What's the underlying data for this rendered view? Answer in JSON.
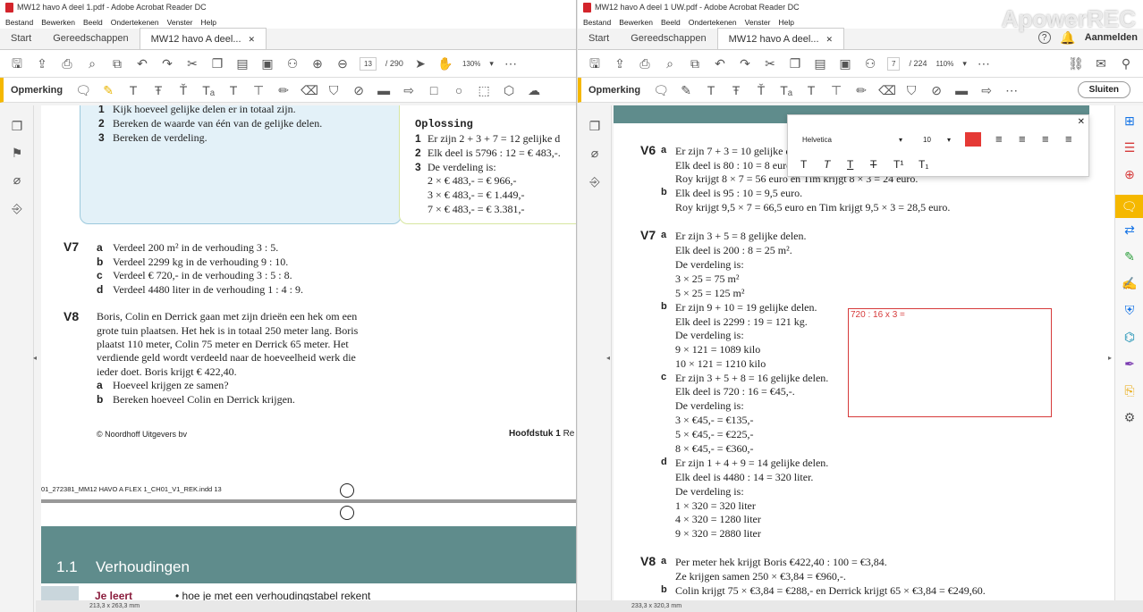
{
  "left": {
    "title": "MW12 havo A deel 1.pdf - Adobe Acrobat Reader DC",
    "menu": [
      "Bestand",
      "Bewerken",
      "Beeld",
      "Ondertekenen",
      "Venster",
      "Help"
    ],
    "tabs": {
      "start": "Start",
      "tools": "Gereedschappen",
      "doc": "MW12 havo A deel..."
    },
    "page_current": "13",
    "page_total": "/ 290",
    "zoom": "130%",
    "anno_label": "Opmerking",
    "pdf": {
      "steps": [
        "1",
        "2",
        "3"
      ],
      "step_text": [
        "Kijk hoeveel gelijke delen er in totaal zijn.",
        "Bereken de waarde van één van de gelijke delen.",
        "Bereken de verdeling."
      ],
      "opl_title": "Oplossing",
      "opl_lines": [
        "Er zijn 2 + 3 + 7 = 12 gelijke d",
        "Elk deel is 5796 : 12 = € 483,-.",
        "De verdeling is:"
      ],
      "opl_calc": [
        "2 × € 483,- = € 966,-",
        "3 × € 483,- = € 1.449,-",
        "7 × € 483,- = € 3.381,-"
      ],
      "v7_no": "V7",
      "v7": [
        {
          "l": "a",
          "t": "Verdeel 200 m² in de verhouding 3 : 5."
        },
        {
          "l": "b",
          "t": "Verdeel 2299 kg in de verhouding 9 : 10."
        },
        {
          "l": "c",
          "t": "Verdeel € 720,- in de verhouding 3 : 5 : 8."
        },
        {
          "l": "d",
          "t": "Verdeel 4480 liter in de verhouding 1 : 4 : 9."
        }
      ],
      "v8_no": "V8",
      "v8_text": [
        "Boris, Colin en Derrick gaan met zijn drieën een hek om een",
        "grote tuin plaatsen. Het hek is in totaal 250 meter lang. Boris",
        "plaatst 110 meter, Colin 75 meter en Derrick 65 meter. Het",
        "verdiende geld wordt verdeeld naar de hoeveelheid werk die",
        "ieder doet. Boris krijgt € 422,40."
      ],
      "v8_q": [
        {
          "l": "a",
          "t": "Hoeveel krijgen ze samen?"
        },
        {
          "l": "b",
          "t": "Bereken hoeveel Colin en Derrick krijgen."
        }
      ],
      "copyright": "© Noordhoff Uitgevers bv",
      "chapter": "Hoofdstuk 1",
      "chapter_tail": "Re",
      "indd": "01_272381_MM12 HAVO A FLEX 1_CH01_V1_REK.indd   13",
      "section_no": "1.1",
      "section_title": "Verhoudingen",
      "je_leert": "Je leert",
      "je_leert_item": "• hoe je met een verhoudingstabel rekent"
    },
    "status": "213,3 x 263,3 mm"
  },
  "right": {
    "title": "MW12 havo A deel 1 UW.pdf - Adobe Acrobat Reader DC",
    "menu": [
      "Bestand",
      "Bewerken",
      "Beeld",
      "Ondertekenen",
      "Venster",
      "Help"
    ],
    "tabs": {
      "start": "Start",
      "tools": "Gereedschappen",
      "doc": "MW12 havo A deel..."
    },
    "help": "?",
    "signin": "Aanmelden",
    "page_current": "7",
    "page_total": "/ 224",
    "zoom": "110%",
    "anno_label": "Opmerking",
    "close_label": "Sluiten",
    "font_name": "Helvetica",
    "font_size": "10",
    "text_color": "#e53935",
    "pdf": {
      "v6_no": "V6",
      "v6": [
        "Er zijn 7 + 3 = 10 gelijke d",
        "Elk deel is 80 : 10 = 8 euro",
        "Roy krijgt 8 × 7 = 56 euro en Tim krijgt 8 × 3 = 24 euro.",
        "Elk deel is 95 : 10 = 9,5 euro.",
        "Roy krijgt 9,5 × 7 = 66,5 euro en Tim krijgt 9,5 × 3 = 28,5 euro."
      ],
      "v7_no": "V7",
      "v7a": [
        "Er zijn 3 + 5 = 8 gelijke delen.",
        "Elk deel is 200 : 8 = 25 m².",
        "De verdeling is:",
        "3 × 25 = 75 m²",
        "5 × 25 = 125 m²"
      ],
      "v7b": [
        "Er zijn 9 + 10 = 19 gelijke delen.",
        "Elk deel is 2299 : 19 = 121 kg.",
        "De verdeling is:",
        "9 × 121 = 1089 kilo",
        "10 × 121 = 1210 kilo"
      ],
      "v7c": [
        "Er zijn 3 + 5 + 8 = 16 gelijke delen.",
        "Elk deel is 720 : 16 = €45,-.",
        "De verdeling is:",
        "3 × €45,- = €135,-",
        "5 × €45,- = €225,-",
        "8 × €45,- = €360,-"
      ],
      "v7d": [
        "Er zijn 1 + 4 + 9 = 14 gelijke delen.",
        "Elk deel is 4480 : 14 = 320 liter.",
        "De verdeling is:",
        "1 × 320 = 320 liter",
        "4 × 320 = 1280 liter",
        "9 × 320 = 2880 liter"
      ],
      "v8_no": "V8",
      "v8": [
        "Per meter hek krijgt Boris €422,40 : 100 = €3,84.",
        "Ze krijgen samen 250 × €3,84 = €960,-.",
        "Colin krijgt 75 × €3,84 = €288,- en Derrick krijgt 65 × €3,84 = €249,60."
      ],
      "letters": [
        "a",
        "b",
        "a",
        "b",
        "c",
        "d",
        "a",
        "b"
      ]
    },
    "annotation_text": "720 : 16 x 3 =",
    "status": "233,3 x 320,3 mm",
    "watermark": "ApowerREC"
  }
}
